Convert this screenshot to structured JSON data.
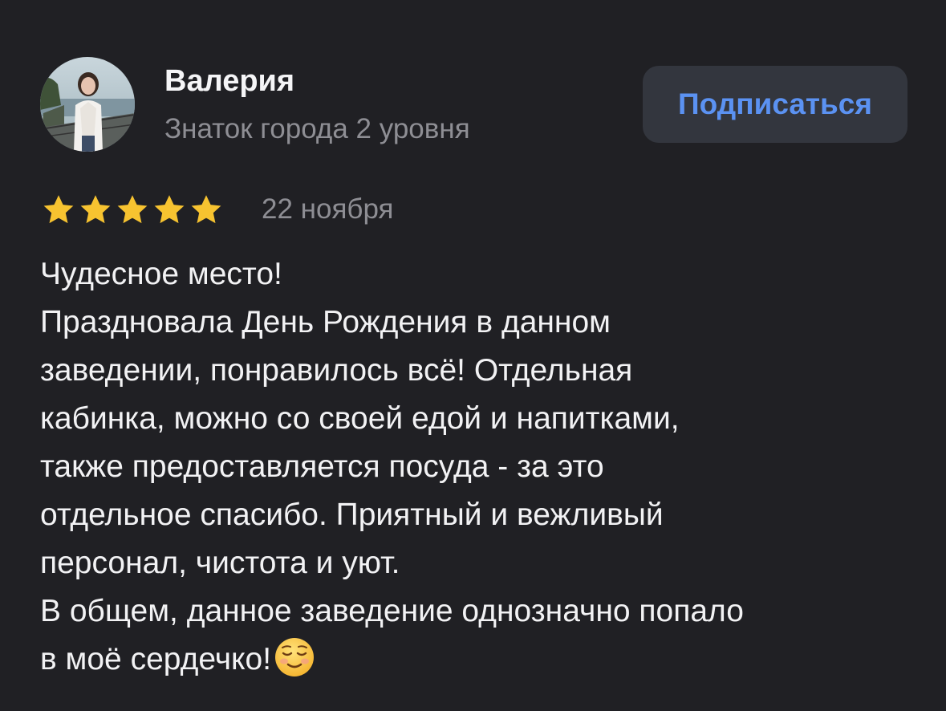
{
  "author": {
    "name": "Валерия",
    "status": "Знаток города 2 уровня",
    "avatar_icon": "user-photo"
  },
  "subscribe": {
    "label": "Подписаться"
  },
  "rating": {
    "value": 5,
    "max": 5,
    "star_color": "#f7c330",
    "date": "22 ноября"
  },
  "review": {
    "lines": [
      "Чудесное место!",
      "Праздновала День Рождения в данном",
      "заведении, понравилось всё! Отдельная",
      "кабинка, можно со своей едой и напитками,",
      "также предоставляется посуда - за это",
      "отдельное спасибо. Приятный и вежливый",
      "персонал, чистота и уют.",
      "В общем, данное заведение однозначно попало",
      "в моё сердечко!"
    ],
    "emoji": "smiling-face-icon"
  },
  "colors": {
    "background": "#202024",
    "accent": "#5b92f2",
    "button_bg": "#33363e",
    "secondary_text": "#8e8e94"
  }
}
